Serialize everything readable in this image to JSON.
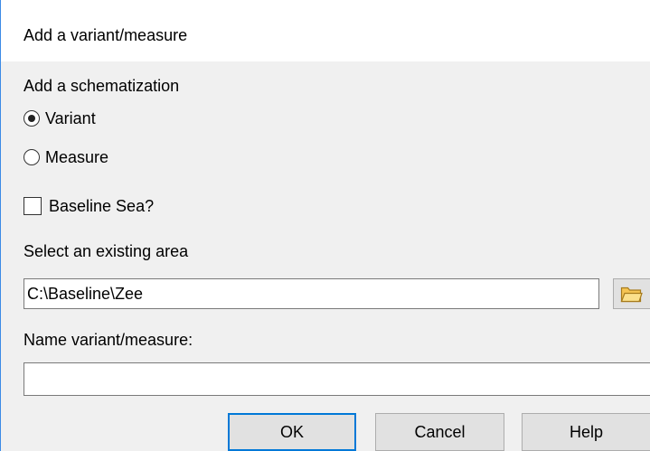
{
  "window": {
    "title": "Add a variant/measure"
  },
  "schematization": {
    "heading": "Add a schematization",
    "options": [
      {
        "label": "Variant",
        "checked": true
      },
      {
        "label": "Measure",
        "checked": false
      }
    ]
  },
  "baseline_sea": {
    "label": "Baseline Sea?",
    "checked": false
  },
  "area": {
    "label": "Select an existing area",
    "value": "C:\\Baseline\\Zee",
    "browse_icon": "folder-icon"
  },
  "name": {
    "label": "Name variant/measure:",
    "value": ""
  },
  "buttons": {
    "ok": "OK",
    "cancel": "Cancel",
    "help": "Help"
  },
  "colors": {
    "accent": "#0078d7",
    "window_border": "#3c8be6",
    "folder": "#f5c453"
  }
}
